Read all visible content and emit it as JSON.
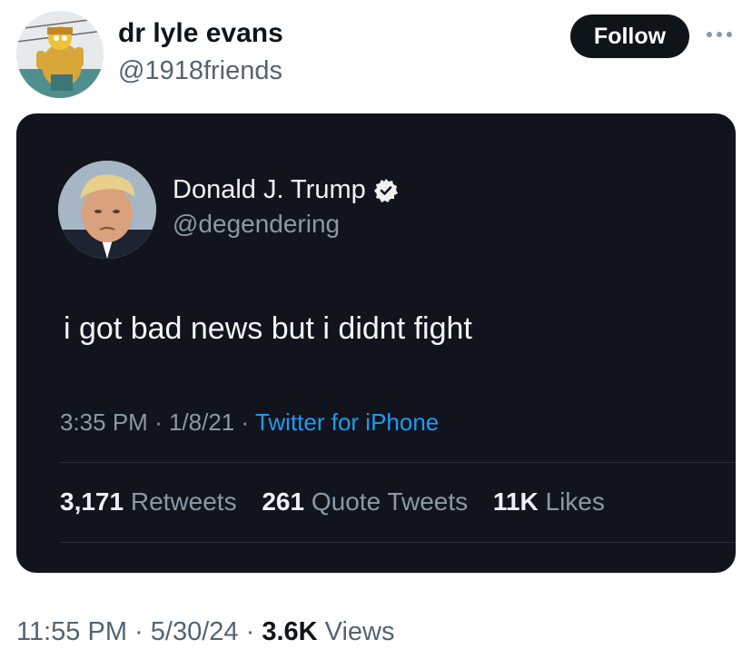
{
  "author": {
    "display_name": "dr lyle evans",
    "handle": "@1918friends",
    "avatar_icon": "cartoon-statue-avatar"
  },
  "follow_label": "Follow",
  "more_icon": "more-dots-icon",
  "embedded_tweet": {
    "display_name": "Donald J. Trump",
    "verified": true,
    "handle": "@degendering",
    "text": "i got bad news but i didnt fight",
    "time": "3:35 PM",
    "date": "1/8/21",
    "source": "Twitter for iPhone",
    "separator": "·",
    "stats": {
      "retweets_count": "3,171",
      "retweets_label": "Retweets",
      "quote_count": "261",
      "quote_label": "Quote Tweets",
      "likes_count": "11K",
      "likes_label": "Likes"
    }
  },
  "footer": {
    "time": "11:55 PM",
    "date": "5/30/24",
    "views_count": "3.6K",
    "views_label": "Views",
    "separator": "·"
  },
  "colors": {
    "embed_bg": "#11141d",
    "link_blue": "#1d9bf0",
    "follow_bg": "#0f1419"
  }
}
